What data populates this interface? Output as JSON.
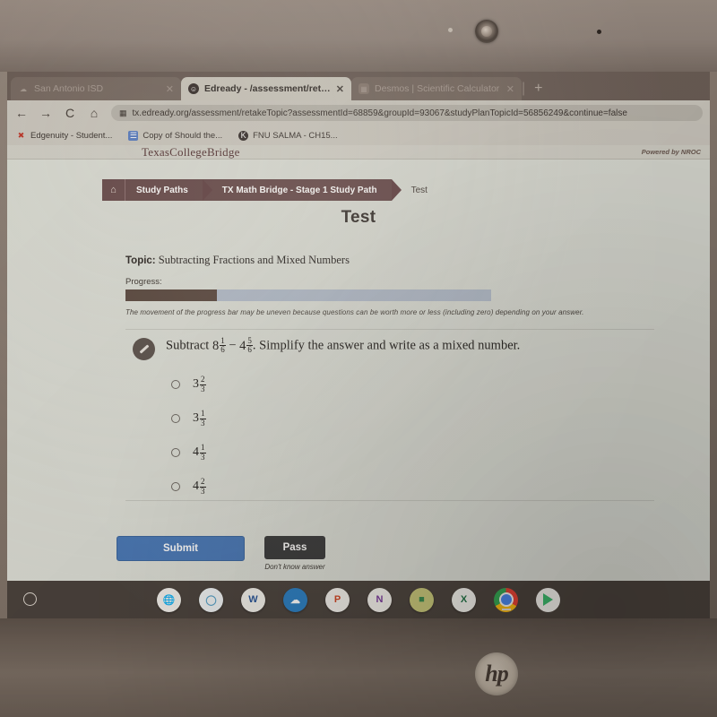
{
  "device": {
    "brand": "hp"
  },
  "browser": {
    "tabs": [
      {
        "title": "San Antonio ISD",
        "active": false,
        "favicon": "cloud-icon"
      },
      {
        "title": "Edready - /assessment/retakeTo",
        "active": true,
        "favicon": "edready-icon"
      },
      {
        "title": "Desmos | Scientific Calculator",
        "active": false,
        "favicon": "desmos-icon"
      }
    ],
    "new_tab_label": "+",
    "nav": {
      "back": "←",
      "forward": "→",
      "reload": "C",
      "home": "⌂"
    },
    "url": "tx.edready.org/assessment/retakeTopic?assessmentId=68859&groupId=93067&studyPlanTopicId=56856249&continue=false",
    "bookmarks": [
      {
        "label": "Edgenuity - Student...",
        "icon": "edgenuity-icon"
      },
      {
        "label": "Copy of Should the...",
        "icon": "google-docs-icon"
      },
      {
        "label": "FNU SALMA - CH15...",
        "icon": "kahoot-icon"
      }
    ]
  },
  "site": {
    "logo": "TexasCollegeBridge",
    "powered_by": "Powered by NROC"
  },
  "breadcrumb": {
    "home_icon": "home-icon",
    "items": [
      "Study Paths",
      "TX Math Bridge - Stage 1 Study Path",
      "Test"
    ]
  },
  "page": {
    "title": "Test",
    "topic_label": "Topic:",
    "topic_value": "Subtracting Fractions and Mixed Numbers",
    "progress_label": "Progress:",
    "progress_percent": 25,
    "progress_note": "The movement of the progress bar may be uneven because questions can be worth more or less (including zero) depending on your answer."
  },
  "question": {
    "icon": "pencil-icon",
    "prefix": "Subtract ",
    "operand1": {
      "whole": "8",
      "num": "1",
      "den": "6"
    },
    "operator": " − ",
    "operand2": {
      "whole": "4",
      "num": "5",
      "den": "6"
    },
    "suffix": ". Simplify the answer and write as a mixed number.",
    "options": [
      {
        "whole": "3",
        "num": "2",
        "den": "3",
        "selected": false
      },
      {
        "whole": "3",
        "num": "1",
        "den": "3",
        "selected": false
      },
      {
        "whole": "4",
        "num": "1",
        "den": "3",
        "selected": false
      },
      {
        "whole": "4",
        "num": "2",
        "den": "3",
        "selected": false
      }
    ]
  },
  "actions": {
    "submit_label": "Submit",
    "pass_label": "Pass",
    "pass_note": "Don't know answer",
    "submit_color": "#4a79b8",
    "pass_color": "#3b3b3b"
  },
  "shelf": {
    "launcher": "launcher-icon",
    "apps": [
      {
        "name": "web-store-icon",
        "glyph": "⊕",
        "bg": "#f2f1ed",
        "fg": "#2c7fc4"
      },
      {
        "name": "search-bubble-icon",
        "glyph": "○",
        "bg": "#eef3f5",
        "fg": "#5ba3c9"
      },
      {
        "name": "word-icon",
        "glyph": "W",
        "bg": "#f4f3ef",
        "fg": "#2a5699"
      },
      {
        "name": "onedrive-icon",
        "glyph": "☁",
        "bg": "#f4f3ef",
        "fg": "#2c7fc4"
      },
      {
        "name": "powerpoint-icon",
        "glyph": "P",
        "bg": "#f4f3ef",
        "fg": "#d04423"
      },
      {
        "name": "onenote-icon",
        "glyph": "N",
        "bg": "#f4f3ef",
        "fg": "#7a3b9b"
      },
      {
        "name": "classroom-icon",
        "glyph": "■",
        "bg": "#f4f3ef",
        "fg": "#3a8a4e"
      },
      {
        "name": "excel-icon",
        "glyph": "X",
        "bg": "#f4f3ef",
        "fg": "#217346"
      },
      {
        "name": "chrome-icon",
        "glyph": "",
        "bg": "",
        "fg": ""
      },
      {
        "name": "play-store-icon",
        "glyph": "",
        "bg": "",
        "fg": ""
      }
    ]
  }
}
